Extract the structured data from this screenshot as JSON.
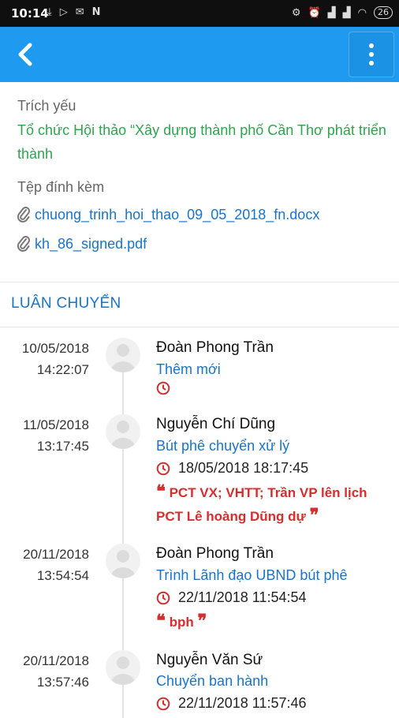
{
  "status_bar": {
    "time": "10:14",
    "battery": "26"
  },
  "header": {
    "back_icon": "chevron-left-icon",
    "menu_icon": "vertical-dots-icon"
  },
  "document": {
    "summary_label": "Trích yếu",
    "summary_text": "Tổ chức Hội thảo “Xây dựng thành phố Cần Thơ phát triển thành",
    "attachments_label": "Tệp đính kèm",
    "attachments": [
      {
        "name": "chuong_trinh_hoi_thao_09_05_2018_fn.docx"
      },
      {
        "name": "kh_86_signed.pdf"
      }
    ]
  },
  "rotation": {
    "title": "LUÂN CHUYỂN",
    "entries": [
      {
        "date": "10/05/2018",
        "time": "14:22:07",
        "name": "Đoàn Phong Trần",
        "action": "Thêm mới",
        "deadline": "",
        "comment": ""
      },
      {
        "date": "11/05/2018",
        "time": "13:17:45",
        "name": "Nguyễn Chí Dũng",
        "action": "Bút phê chuyển xử lý",
        "deadline": "18/05/2018 18:17:45",
        "comment": "PCT VX; VHTT; Trần VP lên lịch PCT Lê hoàng Dũng dự"
      },
      {
        "date": "20/11/2018",
        "time": "13:54:54",
        "name": "Đoàn Phong Trần",
        "action": "Trình Lãnh đạo UBND bút phê",
        "deadline": "22/11/2018 11:54:54",
        "comment": "bph"
      },
      {
        "date": "20/11/2018",
        "time": "13:57:46",
        "name": "Nguyễn Văn Sứ",
        "action": "Chuyển ban hành",
        "deadline": "22/11/2018 11:57:46",
        "comment": ""
      }
    ]
  },
  "colors": {
    "appbar": "#1e9bf0",
    "accent": "#1a73c9",
    "summary": "#2ea44f",
    "comment": "#d32f2f"
  }
}
